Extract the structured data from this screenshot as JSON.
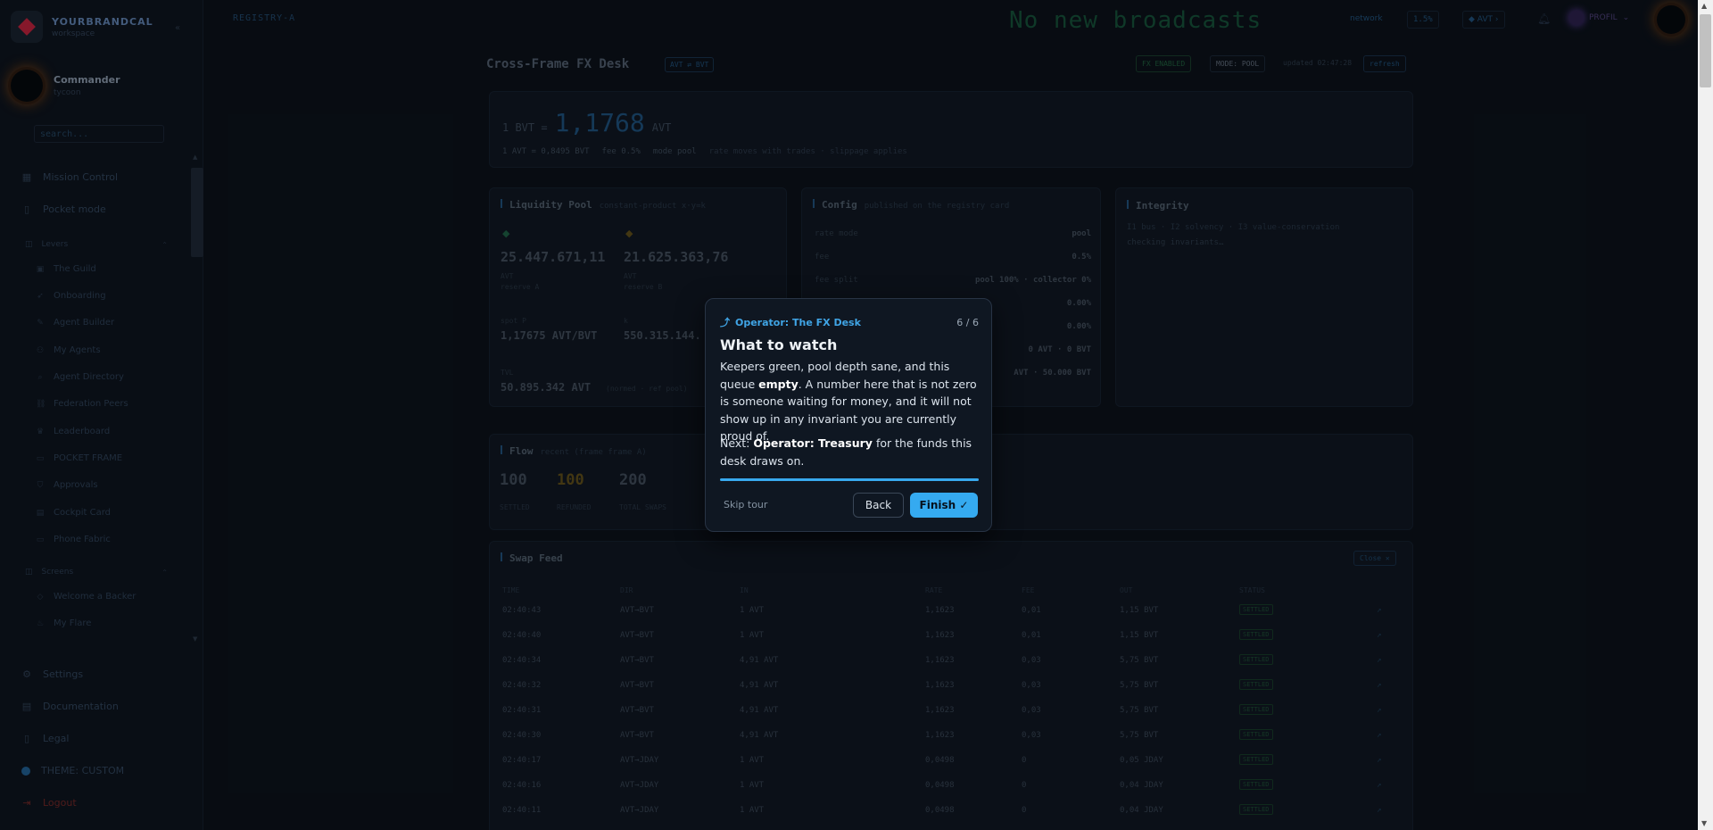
{
  "sidebar": {
    "brand_name": "YOURBRANDCAL",
    "brand_sub": "workspace",
    "profile_name": "Commander",
    "profile_role": "tycoon",
    "search_placeholder": "search...",
    "nav_main": [
      {
        "label": "Mission Control",
        "icon": "grid-icon"
      },
      {
        "label": "Pocket mode",
        "icon": "phone-icon"
      }
    ],
    "group_levers": "Levers",
    "levers_items": [
      {
        "label": "The Guild",
        "icon": "building-icon"
      },
      {
        "label": "Onboarding",
        "icon": "rocket-icon"
      },
      {
        "label": "Agent Builder",
        "icon": "wrench-icon"
      },
      {
        "label": "My Agents",
        "icon": "users-icon"
      },
      {
        "label": "Agent Directory",
        "icon": "search-icon"
      },
      {
        "label": "Federation Peers",
        "icon": "link-icon"
      },
      {
        "label": "Leaderboard",
        "icon": "trophy-icon"
      },
      {
        "label": "POCKET FRAME",
        "icon": "frame-icon"
      },
      {
        "label": "Approvals",
        "icon": "shield-icon"
      },
      {
        "label": "Cockpit Card",
        "icon": "card-icon"
      },
      {
        "label": "Phone Fabric",
        "icon": "monitor-icon"
      }
    ],
    "group_screens": "Screens",
    "screens_items": [
      {
        "label": "Welcome a Backer",
        "icon": "handshake-icon"
      },
      {
        "label": "My Flare",
        "icon": "flame-icon"
      }
    ],
    "settings": "Settings",
    "documentation": "Documentation",
    "legal": "Legal",
    "theme": "THEME: CUSTOM",
    "logout": "Logout"
  },
  "topbar": {
    "registry": "REGISTRY-A",
    "broadcast": "No new broadcasts",
    "chip_network": "network",
    "chip_rate": "1.5%",
    "chip_avt": "AVT",
    "user_label": "PROFIL"
  },
  "header": {
    "title": "Cross-Frame FX Desk",
    "pair_pill": "AVT ⇄ BVT",
    "chip_fx": "FX ENABLED",
    "chip_mode": "MODE: POOL",
    "updated": "updated 02:47:28",
    "refresh": "refresh"
  },
  "rate": {
    "prefix": "1 BVT =",
    "value": "1,1768",
    "unit": "AVT",
    "inverse": "1 AVT = 0,8495 BVT",
    "fee": "fee 0.5%",
    "mode": "mode pool",
    "note": "rate moves with trades · slippage applies"
  },
  "liquidity": {
    "title": "Liquidity Pool",
    "sub": "constant-product x·y=k",
    "reserve_a": "25.447.671,11",
    "reserve_a_unit": "AVT",
    "reserve_a_label": "reserve A",
    "reserve_b": "21.625.363,76",
    "reserve_b_unit": "AVT",
    "reserve_b_label": "reserve B",
    "spot_label": "spot P",
    "spot": "1,17675 AVT/BVT",
    "k_label": "k",
    "k": "550.315.144.",
    "tvl_label": "TVL",
    "tvl": "50.895.342 AVT",
    "tvl_note": "(normed · ref pool)"
  },
  "config": {
    "title": "Config",
    "sub": "published on the registry card",
    "rows": [
      {
        "k": "rate mode",
        "v": "pool"
      },
      {
        "k": "fee",
        "v": "0.5%"
      },
      {
        "k": "fee split",
        "v": "pool 100% · collector 0%"
      },
      {
        "k": "",
        "v": "0.00%"
      },
      {
        "k": "",
        "v": "0.00%"
      },
      {
        "k": "",
        "v": "0 AVT · 0 BVT"
      },
      {
        "k": "",
        "v": "AVT · 50.000 BVT"
      }
    ]
  },
  "integrity": {
    "title": "Integrity",
    "sub": "I1 bus · I2 solvency · I3 value-conservation",
    "status": "checking invariants…"
  },
  "flow": {
    "title": "Flow",
    "sub": "recent (frame frame A)",
    "settled": "100",
    "settled_label": "SETTLED",
    "refunded": "100",
    "refunded_label": "REFUNDED",
    "total": "200",
    "total_label": "TOTAL SWAPS"
  },
  "feed": {
    "title": "Swap Feed",
    "close": "Close ✕",
    "headers": [
      "TIME",
      "DIR",
      "IN",
      "RATE",
      "FEE",
      "OUT",
      "STATUS"
    ],
    "rows": [
      [
        "02:40:43",
        "AVT→BVT",
        "1 AVT",
        "1,1623",
        "0,01",
        "1,15 BVT",
        "SETTLED"
      ],
      [
        "02:40:40",
        "AVT→BVT",
        "1 AVT",
        "1,1623",
        "0,01",
        "1,15 BVT",
        "SETTLED"
      ],
      [
        "02:40:34",
        "AVT→BVT",
        "4,91 AVT",
        "1,1623",
        "0,03",
        "5,75 BVT",
        "SETTLED"
      ],
      [
        "02:40:32",
        "AVT→BVT",
        "4,91 AVT",
        "1,1623",
        "0,03",
        "5,75 BVT",
        "SETTLED"
      ],
      [
        "02:40:31",
        "AVT→BVT",
        "4,91 AVT",
        "1,1623",
        "0,03",
        "5,75 BVT",
        "SETTLED"
      ],
      [
        "02:40:30",
        "AVT→BVT",
        "4,91 AVT",
        "1,1623",
        "0,03",
        "5,75 BVT",
        "SETTLED"
      ],
      [
        "02:40:17",
        "AVT→JDAY",
        "1 AVT",
        "0,0498",
        "0",
        "0,05 JDAY",
        "SETTLED"
      ],
      [
        "02:40:16",
        "AVT→JDAY",
        "1 AVT",
        "0,0498",
        "0",
        "0,04 JDAY",
        "SETTLED"
      ],
      [
        "02:40:11",
        "AVT→JDAY",
        "1 AVT",
        "0,0498",
        "0",
        "0,04 JDAY",
        "SETTLED"
      ]
    ]
  },
  "tour": {
    "eyebrow": "Operator: The FX Desk",
    "step": "6 / 6",
    "progress": 1.0,
    "title": "What to watch",
    "body_1": "Keepers green, pool depth sane, and this queue",
    "body_bold": "empty",
    "body_2": ". A number here that is not zero is someone waiting for money, and it will not show up in any invariant you are currently proud of.",
    "next_prefix": "Next:",
    "next_bold": "Operator: Treasury",
    "next_suffix": "for the funds this desk draws on.",
    "skip": "Skip tour",
    "back": "Back",
    "finish": "Finish ✓"
  },
  "colors": {
    "accent": "#35aaf0",
    "brand": "#b3203a",
    "broadcast": "#144c36",
    "refunded": "#5a4a18"
  }
}
